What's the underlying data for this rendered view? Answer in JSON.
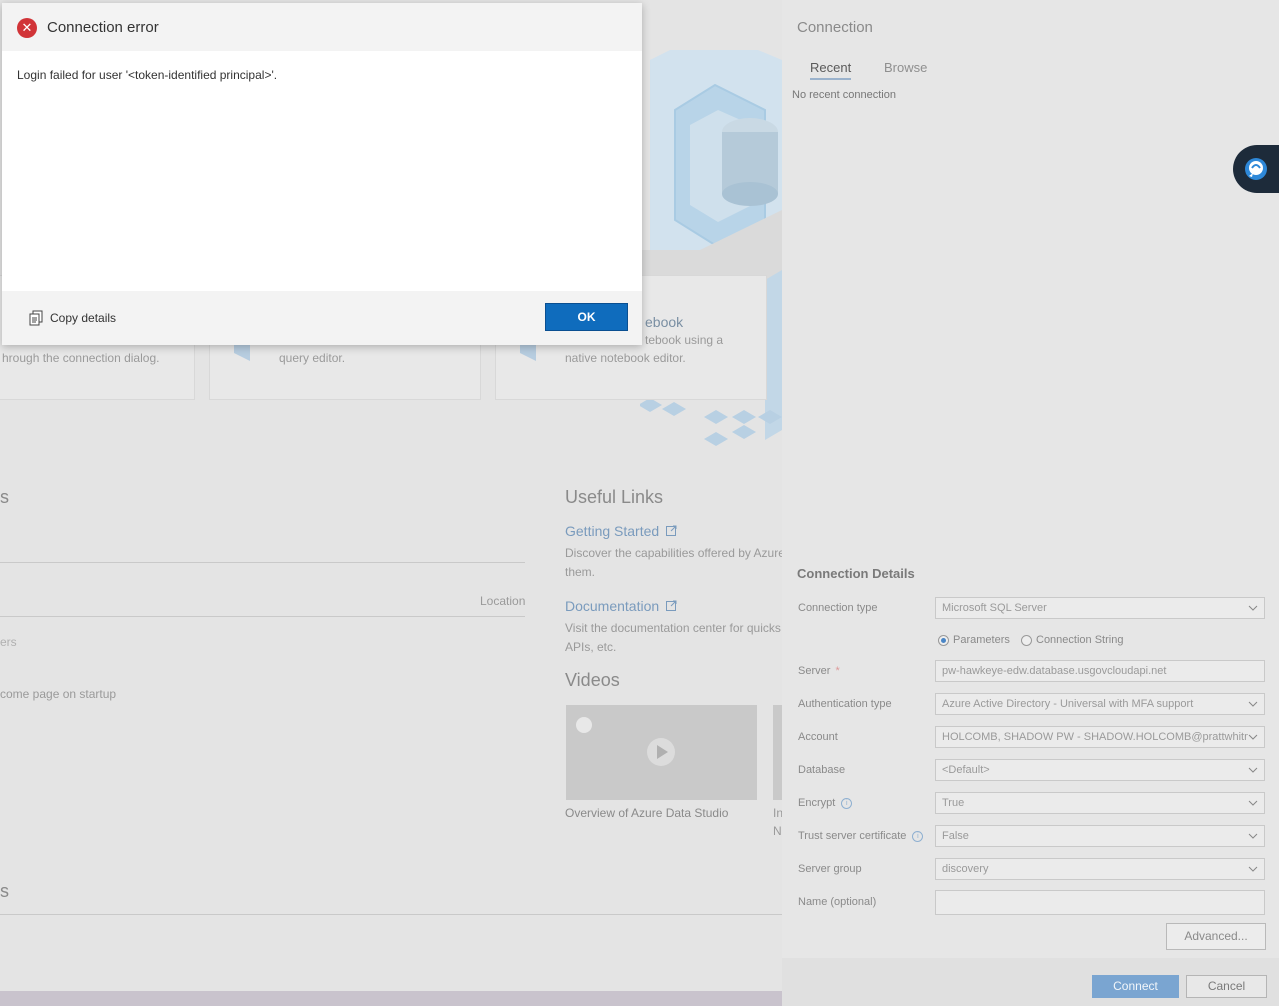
{
  "welcome": {
    "cards": [
      {
        "desc": "hrough the connection dialog."
      },
      {
        "desc": "query editor."
      },
      {
        "title": "ebook",
        "desc_line1": "tebook using a",
        "desc_line2": "native notebook editor."
      }
    ],
    "section_left_heading": "s",
    "location_label": "Location",
    "left_text_1": "ers",
    "left_text_2": "come page on startup",
    "useful_links": {
      "heading": "Useful Links",
      "getting_started": "Getting Started",
      "getting_started_desc_1": "Discover the capabilities offered by Azure",
      "getting_started_desc_2": "them.",
      "documentation": "Documentation",
      "documentation_desc_1": "Visit the documentation center for quicks",
      "documentation_desc_2": "APIs, etc."
    },
    "videos": {
      "heading": "Videos",
      "video1_caption": "Overview of Azure Data Studio",
      "video2_caption_1": "In",
      "video2_caption_2": "N"
    },
    "bottom_heading": "s"
  },
  "connection": {
    "title": "Connection",
    "tabs": [
      {
        "label": "Recent",
        "active": true
      },
      {
        "label": "Browse",
        "active": false
      }
    ],
    "no_recent": "No recent connection",
    "details_title": "Connection Details",
    "fields": {
      "connection_type": {
        "label": "Connection type",
        "value": "Microsoft SQL Server"
      },
      "input_mode": {
        "options": [
          "Parameters",
          "Connection String"
        ],
        "selected": "Parameters"
      },
      "server": {
        "label": "Server",
        "required_mark": "*",
        "value": "pw-hawkeye-edw.database.usgovcloudapi.net"
      },
      "auth_type": {
        "label": "Authentication type",
        "value": "Azure Active Directory - Universal with MFA support"
      },
      "account": {
        "label": "Account",
        "value": "HOLCOMB, SHADOW PW - SHADOW.HOLCOMB@prattwhitne"
      },
      "database": {
        "label": "Database",
        "value": "<Default>"
      },
      "encrypt": {
        "label": "Encrypt",
        "value": "True"
      },
      "trust_cert": {
        "label": "Trust server certificate",
        "value": "False"
      },
      "server_group": {
        "label": "Server group",
        "value": "discovery"
      },
      "name": {
        "label": "Name (optional)",
        "value": ""
      }
    },
    "advanced_label": "Advanced...",
    "connect_label": "Connect",
    "cancel_label": "Cancel"
  },
  "dialog": {
    "title": "Connection error",
    "message": "Login failed for user '<token-identified principal>'.",
    "copy_label": "Copy details",
    "ok_label": "OK"
  },
  "colors": {
    "error_icon": "#d13438",
    "primary_button": "#0f6cbd"
  }
}
